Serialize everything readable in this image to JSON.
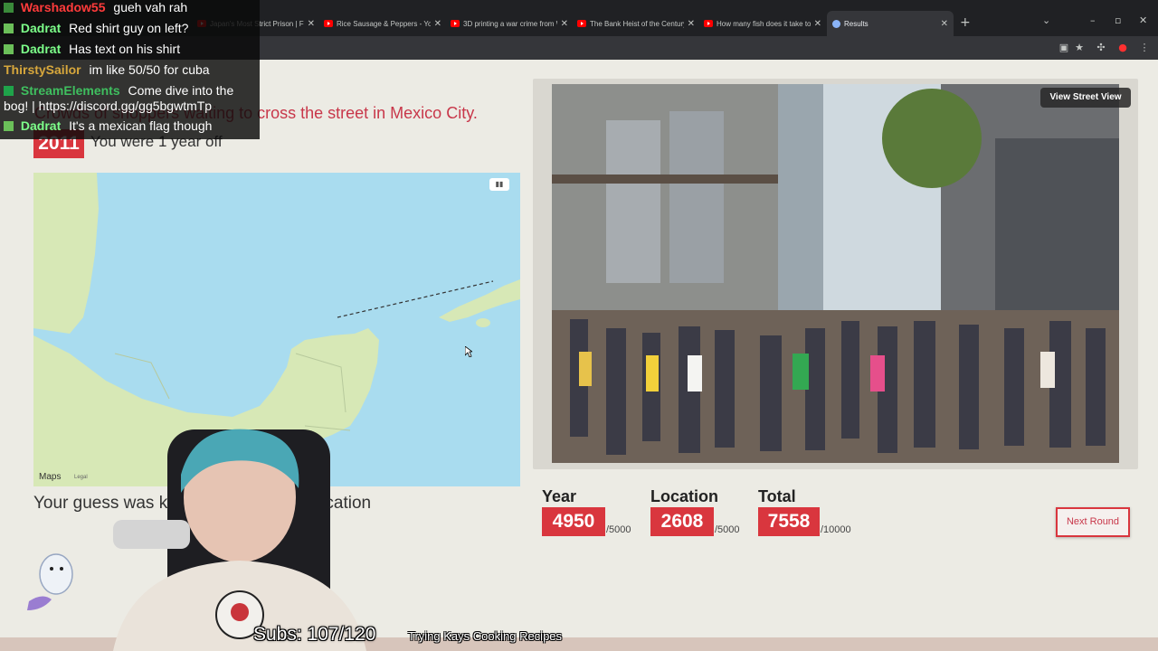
{
  "browser": {
    "tabs": [
      {
        "label": "Japan's Most Strict Prison | Free",
        "icon": "youtube-icon"
      },
      {
        "label": "Rice Sausage & Peppers - YouTube",
        "icon": "youtube-icon"
      },
      {
        "label": "3D printing a war crime from W",
        "icon": "youtube-icon"
      },
      {
        "label": "The Bank Heist of the Century -",
        "icon": "youtube-icon"
      },
      {
        "label": "How many fish does it take to p",
        "icon": "youtube-icon"
      },
      {
        "label": "Results",
        "icon": "globe-icon",
        "active": true
      }
    ],
    "new_tab": "+"
  },
  "result": {
    "description": "Crowds of shoppers waiting to cross the street in Mexico City.",
    "year": "2011",
    "year_feedback": "You were 1 year off",
    "distance_text": "Your guess was km from the correct location",
    "view_street_view": "View Street View",
    "next_round": "Next Round"
  },
  "map": {
    "logo": "Maps",
    "legal": "Legal",
    "control_icon": "map-type-icon"
  },
  "scores": {
    "year": {
      "label": "Year",
      "value": "4950",
      "max": "/5000"
    },
    "location": {
      "label": "Location",
      "value": "2608",
      "max": "/5000"
    },
    "total": {
      "label": "Total",
      "value": "7558",
      "max": "/10000"
    }
  },
  "chat": [
    {
      "user": "Warshadow55",
      "color": "#ff3b3b",
      "text": "gueh vah rah"
    },
    {
      "user": "Dadrat",
      "color": "#7dff8a",
      "text": "Red shirt guy on left?"
    },
    {
      "user": "Dadrat",
      "color": "#7dff8a",
      "text": "Has text on his shirt"
    },
    {
      "user": "ThirstySailor",
      "color": "#d7a73c",
      "text": "im like 50/50 for cuba"
    },
    {
      "user": "StreamElements",
      "color": "#3fbf5f",
      "text": "Come dive into the bog! | https://discord.gg/gg5bgwtmTp"
    },
    {
      "user": "Dadrat",
      "color": "#7dff8a",
      "text": "It's a mexican flag though"
    }
  ],
  "overlay": {
    "subs": "Subs: 107/120",
    "goal": "Trying Kays Cooking Recipes"
  },
  "colors": {
    "accent": "#d9363e",
    "page_bg": "#ecebe4",
    "map_water": "#a9dcef",
    "map_land": "#d7e8b6"
  }
}
